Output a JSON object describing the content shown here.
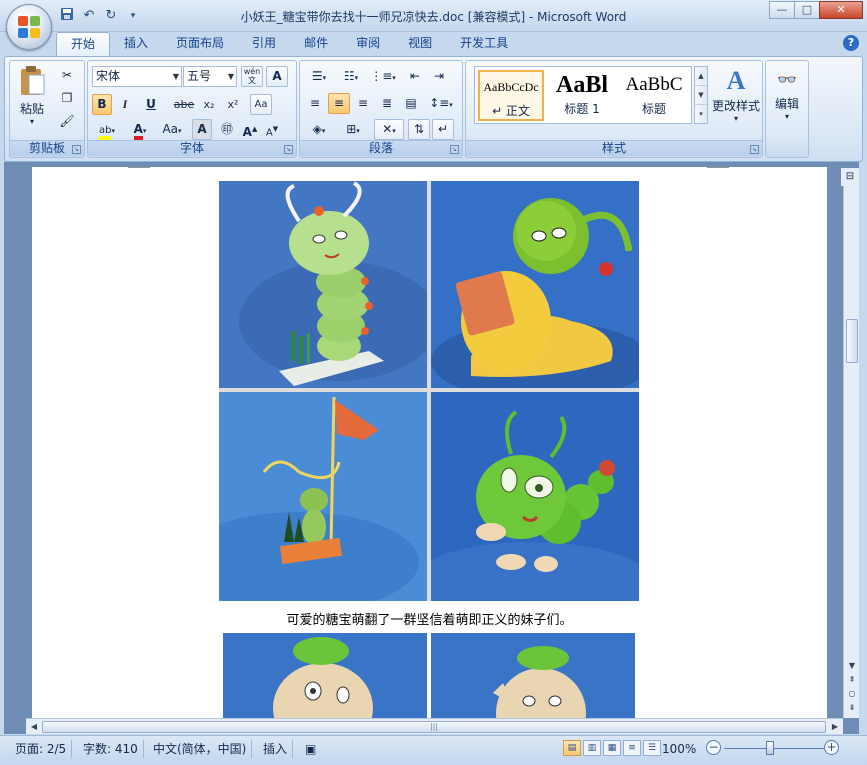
{
  "window": {
    "title": "小妖王_糖宝带你去找十一师兄凉快去.doc [兼容模式] - Microsoft Word",
    "minimize": "—",
    "maximize": "□",
    "close": "✕"
  },
  "quick_access": [
    "save-icon",
    "undo-icon",
    "redo-icon",
    "customize-icon"
  ],
  "tabs": [
    "开始",
    "插入",
    "页面布局",
    "引用",
    "邮件",
    "审阅",
    "视图",
    "开发工具"
  ],
  "active_tab": "开始",
  "ribbon": {
    "clipboard": {
      "name": "剪贴板",
      "paste": "粘贴"
    },
    "font": {
      "name": "字体",
      "family": "宋体",
      "size": "五号",
      "phonetic": "wén",
      "bold": "B",
      "italic": "I",
      "underline": "U",
      "strike": "abe",
      "subscript": "x₂",
      "superscript": "x²",
      "clear": "Aa",
      "highlight": "ab",
      "color": "A",
      "case": "Aa",
      "grow": "A",
      "shrink": "A"
    },
    "paragraph": {
      "name": "段落"
    },
    "styles": {
      "name": "样式",
      "items": [
        {
          "preview": "AaBbCcDc",
          "label": "↵ 正文"
        },
        {
          "preview": "AaBl",
          "label": "标题 1"
        },
        {
          "preview": "AaBbC",
          "label": "标题"
        }
      ],
      "change": "更改样式"
    },
    "editing": {
      "name": "编辑"
    }
  },
  "document": {
    "caption": "可爱的糖宝萌翻了一群坚信着萌即正义的妹子们。"
  },
  "status": {
    "page": "页面: 2/5",
    "words": "字数: 410",
    "language": "中文(简体，中国)",
    "mode": "插入",
    "zoom": "100%"
  },
  "colors": {
    "accent": "#15428b",
    "highlight": "#f8c873",
    "photo_bg": "#3e78c8"
  }
}
